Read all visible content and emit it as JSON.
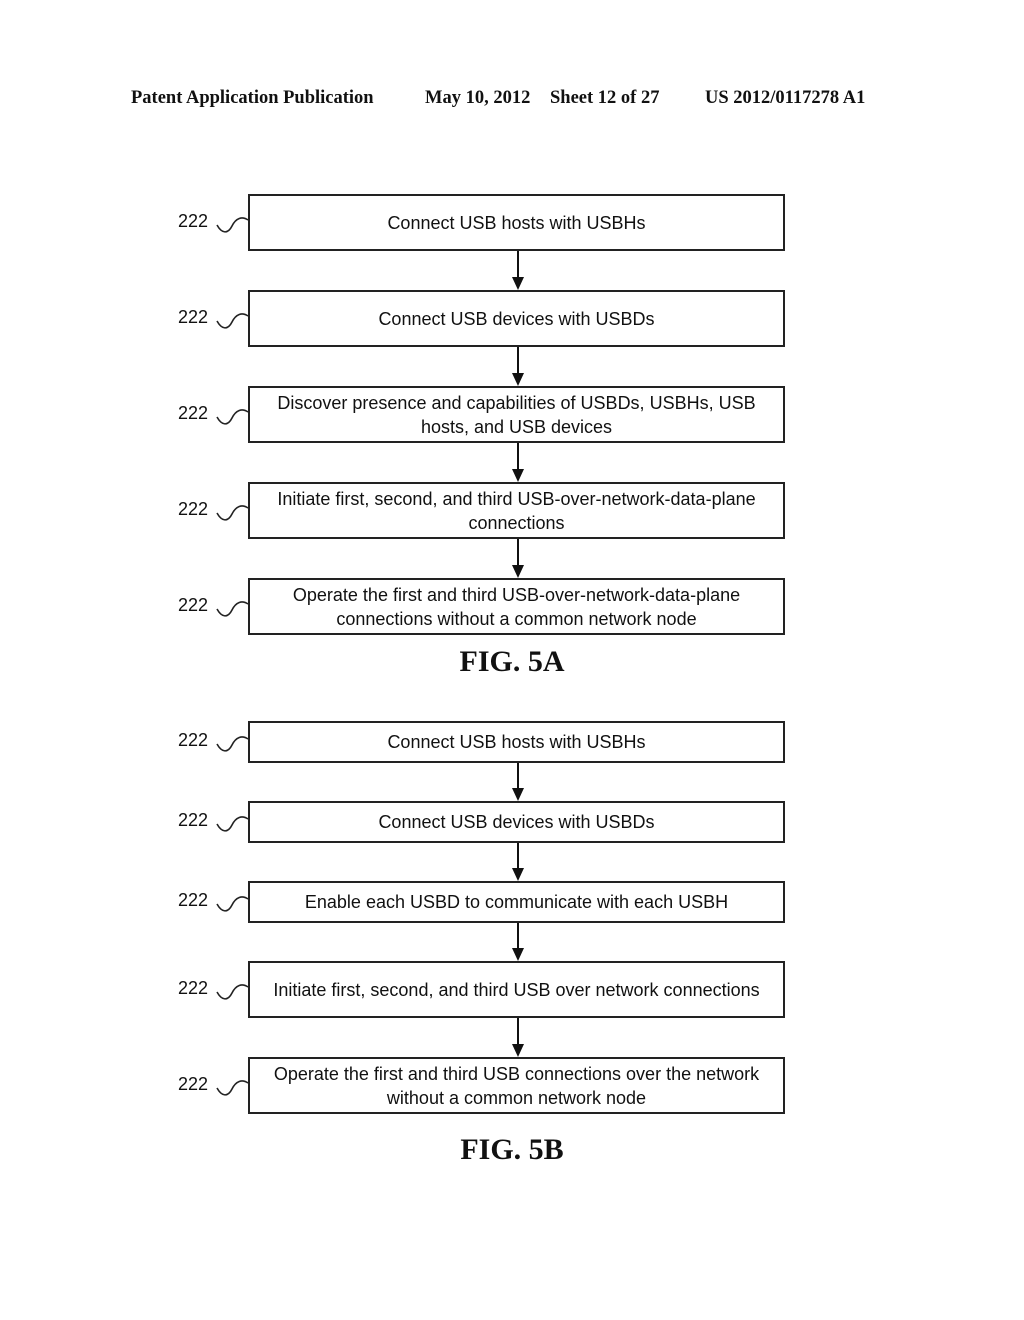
{
  "header": {
    "publication": "Patent Application Publication",
    "date": "May 10, 2012",
    "sheet": "Sheet 12 of 27",
    "number": "US 2012/0117278 A1"
  },
  "figures": [
    {
      "label": "FIG. 5A",
      "steps": [
        {
          "ref": "222",
          "text": "Connect USB hosts with USBHs"
        },
        {
          "ref": "222",
          "text": "Connect USB devices with USBDs"
        },
        {
          "ref": "222",
          "text": "Discover presence and capabilities of USBDs, USBHs, USB hosts, and USB devices"
        },
        {
          "ref": "222",
          "text": "Initiate first, second, and third USB-over-network-data-plane connections"
        },
        {
          "ref": "222",
          "text": "Operate the first and third USB-over-network-data-plane connections without a common network node"
        }
      ]
    },
    {
      "label": "FIG. 5B",
      "steps": [
        {
          "ref": "222",
          "text": "Connect USB hosts with USBHs"
        },
        {
          "ref": "222",
          "text": "Connect USB devices with USBDs"
        },
        {
          "ref": "222",
          "text": "Enable each USBD to communicate with each USBH"
        },
        {
          "ref": "222",
          "text": "Initiate first, second, and third USB over network connections"
        },
        {
          "ref": "222",
          "text": "Operate the first and third USB connections over the network without a common network node"
        }
      ]
    }
  ]
}
